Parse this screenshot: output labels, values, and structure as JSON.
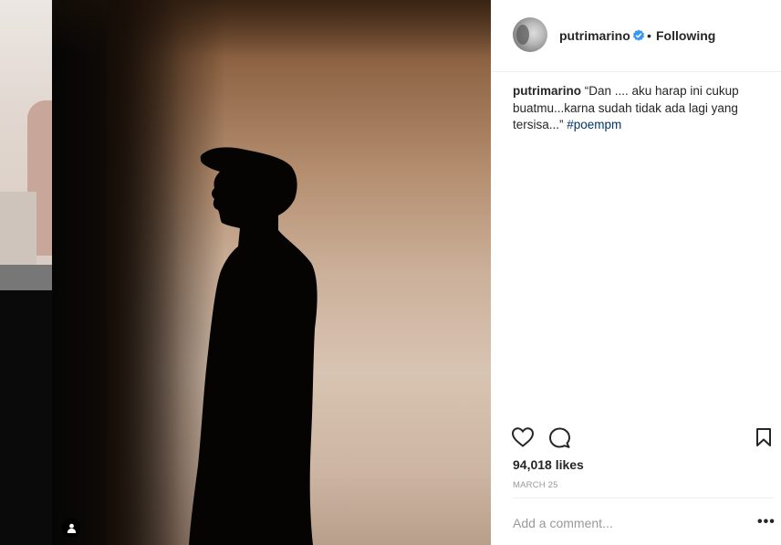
{
  "post": {
    "username": "putrimarino",
    "follow_status": "Following",
    "separator": "•",
    "caption_user": "putrimarino",
    "caption_text": " “Dan .... aku harap ini cukup buatmu...karna sudah tidak ada lagi yang tersisa...” ",
    "hashtag": "#poempm",
    "likes": "94,018 likes",
    "date": "MARCH 25",
    "comment_placeholder": "Add a comment...",
    "more_label": "•••"
  },
  "icons": {
    "verified": "verified-badge-icon",
    "like": "heart-icon",
    "comment": "comment-icon",
    "save": "bookmark-icon",
    "user_tag": "user-tag-icon"
  },
  "colors": {
    "verified": "#3897f0",
    "hashtag": "#003569",
    "muted": "#999999",
    "text": "#262626"
  }
}
